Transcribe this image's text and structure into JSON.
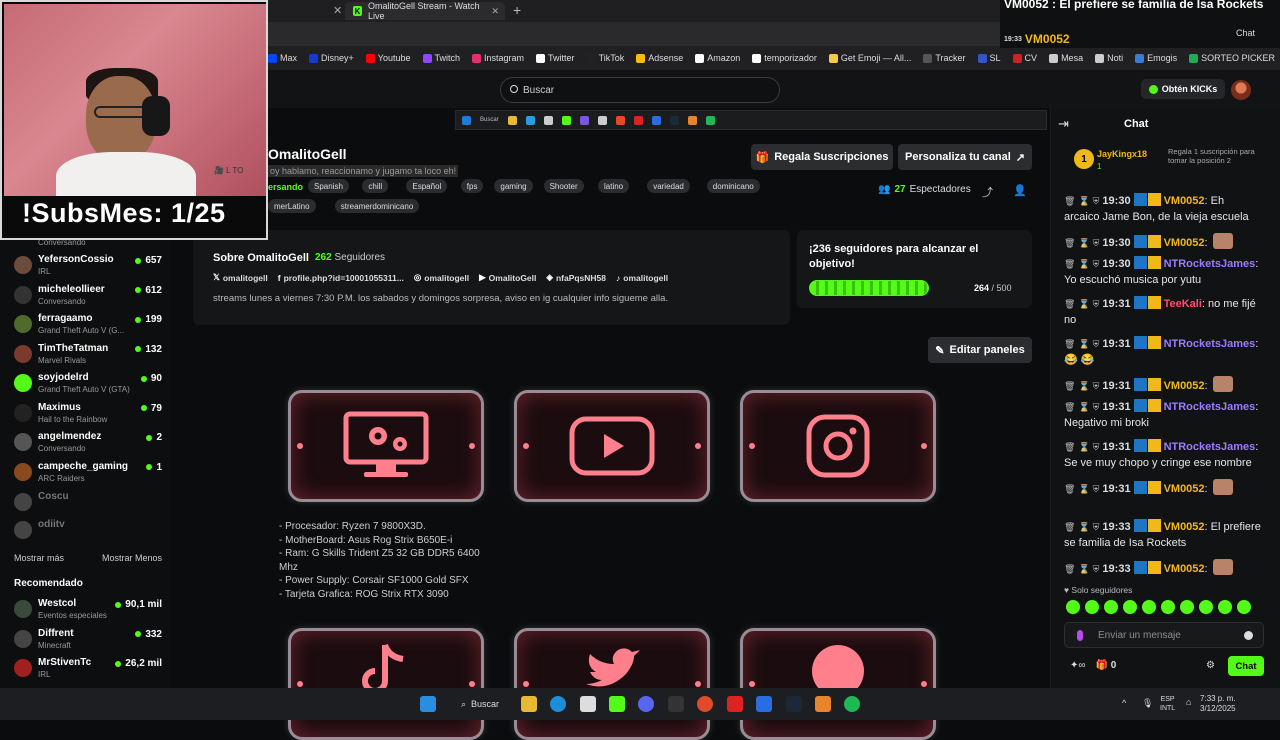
{
  "browser": {
    "tab_title": "OmalitoGell Stream - Watch Live",
    "bookmarks": [
      {
        "label": "Max",
        "color": "#0047ff"
      },
      {
        "label": "Disney+",
        "color": "#113ccf"
      },
      {
        "label": "Youtube",
        "color": "#ff0000"
      },
      {
        "label": "Twitch",
        "color": "#9146ff"
      },
      {
        "label": "Instagram",
        "color": "#e1306c"
      },
      {
        "label": "Twitter",
        "color": "#ffffff"
      },
      {
        "label": "TikTok",
        "color": "#222222"
      },
      {
        "label": "Adsense",
        "color": "#fbbc04"
      },
      {
        "label": "Amazon",
        "color": "#ffffff"
      },
      {
        "label": "temporizador",
        "color": "#ffffff"
      },
      {
        "label": "Get Emoji — All...",
        "color": "#f7c948"
      },
      {
        "label": "Tracker",
        "color": "#555555"
      },
      {
        "label": "SL",
        "color": "#3355cc"
      },
      {
        "label": "CV",
        "color": "#cc2222"
      },
      {
        "label": "Mesa",
        "color": "#cccccc"
      },
      {
        "label": "Noti",
        "color": "#cccccc"
      },
      {
        "label": "Emogis",
        "color": "#3a7bd5"
      },
      {
        "label": "SORTEO PICKER",
        "color": "#22aa55"
      }
    ]
  },
  "topbar": {
    "search_placeholder": "Buscar",
    "get_kicks": "Obtén KICKs"
  },
  "overlay": {
    "subs_counter": "!SubsMes: 1/25",
    "cam_logo": "🎥 L TO"
  },
  "popout": {
    "line1": "VM0052 : El prefiere se familia de Isa Rockets",
    "time": "19:33",
    "user": "VM0052",
    "chat_label": "Chat"
  },
  "channel": {
    "name": "OmalitoGell",
    "title": "oy hablamo, reaccionamo y jugamo ta loco eh!",
    "category": "ersando",
    "tags_row1": [
      "Spanish",
      "chill",
      "Español",
      "fps",
      "gaming",
      "Shooter",
      "latino",
      "variedad",
      "dominicano"
    ],
    "tags_row2": [
      "merLatino",
      "streamerdominicano"
    ],
    "gift_subs": "Regala Suscripciones",
    "customize": "Personaliza tu canal",
    "viewers_count": "27",
    "viewers_label": "Espectadores"
  },
  "about": {
    "title": "Sobre OmalitoGell",
    "followers_count": "262",
    "followers_label": "Seguidores",
    "links": [
      {
        "icon": "x-icon",
        "glyph": "𝕏",
        "label": "omalitogell"
      },
      {
        "icon": "facebook-icon",
        "glyph": "f",
        "label": "profile.php?id=10001055311..."
      },
      {
        "icon": "instagram-icon",
        "glyph": "◎",
        "label": "omalitogell"
      },
      {
        "icon": "youtube-icon",
        "glyph": "▶",
        "label": "OmalitoGell"
      },
      {
        "icon": "discord-icon",
        "glyph": "◈",
        "label": "nfaPqsNH58"
      },
      {
        "icon": "tiktok-icon",
        "glyph": "♪",
        "label": "omalitogell"
      }
    ],
    "description": "streams lunes a viernes 7:30 P.M. los sabados y domingos sorpresa, aviso en ig cualquier info sigueme alla."
  },
  "goal": {
    "title": "¡236 seguidores para alcanzar el objetivo!",
    "current": "264",
    "target": "500",
    "progress": 0.528
  },
  "edit_panels": "Editar paneles",
  "specs": [
    "- Procesador: Ryzen 7 9800X3D.",
    "- MotherBoard: Asus Rog Strix B650E-i",
    "- Ram: G Skills Trident Z5 32 GB DDR5 6400 Mhz",
    "- Power Supply: Corsair SF1000 Gold SFX",
    "- Tarjeta Grafica: ROG Strix RTX 3090"
  ],
  "sidebar": {
    "prev_category": "Conversando",
    "following": [
      {
        "name": "YefersonCossio",
        "category": "IRL",
        "viewers": "657",
        "color": "#6b4b3a"
      },
      {
        "name": "micheleollieer",
        "category": "Conversando",
        "viewers": "612",
        "color": "#333333"
      },
      {
        "name": "ferragaamo",
        "category": "Grand Theft Auto V (G...",
        "viewers": "199",
        "color": "#4f6b2c"
      },
      {
        "name": "TimTheTatman",
        "category": "Marvel Rivals",
        "viewers": "132",
        "color": "#7a3b2c"
      },
      {
        "name": "soyjodelrd",
        "category": "Grand Theft Auto V (GTA)",
        "viewers": "90",
        "color": "#53fc18"
      },
      {
        "name": "Maximus",
        "category": "Hail to the Rainbow",
        "viewers": "79",
        "color": "#222222"
      },
      {
        "name": "angelmendez",
        "category": "Conversando",
        "viewers": "2",
        "color": "#555555"
      },
      {
        "name": "campeche_gaming",
        "category": "ARC Raiders",
        "viewers": "1",
        "color": "#8a4a20"
      }
    ],
    "offline": [
      "Coscu",
      "odiitv"
    ],
    "show_more": "Mostrar más",
    "show_less": "Mostrar Menos",
    "recommended_title": "Recomendado",
    "recommended": [
      {
        "name": "Westcol",
        "category": "Eventos especiales",
        "viewers": "90,1 mil",
        "color": "#3a4a3a"
      },
      {
        "name": "Diffrent",
        "category": "Minecraft",
        "viewers": "332",
        "color": "#444444"
      },
      {
        "name": "MrStivenTc",
        "category": "IRL",
        "viewers": "26,2 mil",
        "color": "#a02020"
      }
    ]
  },
  "chat": {
    "header": "Chat",
    "pinned": {
      "badge": "1",
      "user": "JayKingx18",
      "value": "1",
      "text": "Regala 1 suscripción para tomar la posición 2"
    },
    "messages": [
      {
        "time": "19:30",
        "user": "VM0052",
        "color": "#f1b81c",
        "text": "Eh arcaico Jame Bon, de la vieja escuela",
        "emote": false
      },
      {
        "time": "19:30",
        "user": "VM0052",
        "color": "#f1b81c",
        "text": "",
        "emote": true
      },
      {
        "time": "19:30",
        "user": "NTRocketsJames",
        "color": "#9b7bff",
        "text": "Yo escuchó musica por yutu",
        "emote": false
      },
      {
        "time": "19:31",
        "user": "TeeKali",
        "color": "#ff4d6d",
        "text": "no me fijé no",
        "emote": false
      },
      {
        "time": "19:31",
        "user": "NTRocketsJames",
        "color": "#9b7bff",
        "text": "😂 😂",
        "emote": false
      },
      {
        "time": "19:31",
        "user": "VM0052",
        "color": "#f1b81c",
        "text": "",
        "emote": true
      },
      {
        "time": "19:31",
        "user": "NTRocketsJames",
        "color": "#9b7bff",
        "text": "Negativo mi broki",
        "emote": false
      },
      {
        "time": "19:31",
        "user": "NTRocketsJames",
        "color": "#9b7bff",
        "text": "Se ve muy chopo y cringe ese nombre",
        "emote": false
      },
      {
        "time": "19:31",
        "user": "VM0052",
        "color": "#f1b81c",
        "text": "",
        "emote": true
      },
      {
        "time": "19:33",
        "user": "VM0052",
        "color": "#f1b81c",
        "text": "El prefiere se familia de Isa Rockets",
        "emote": false
      },
      {
        "time": "19:33",
        "user": "VM0052",
        "color": "#f1b81c",
        "text": "",
        "emote": true
      }
    ],
    "followers_only": "Solo seguidores",
    "input_placeholder": "Enviar un mensaje",
    "kicks_count": "0",
    "send_label": "Chat"
  },
  "taskbar": {
    "search_label": "Buscar",
    "lang": "ESP",
    "lang2": "INTL",
    "time": "7:33 p. m.",
    "date": "3/12/2025"
  },
  "colors": {
    "kick_green": "#53fc18",
    "panel_glow": "#ff5c6c"
  }
}
